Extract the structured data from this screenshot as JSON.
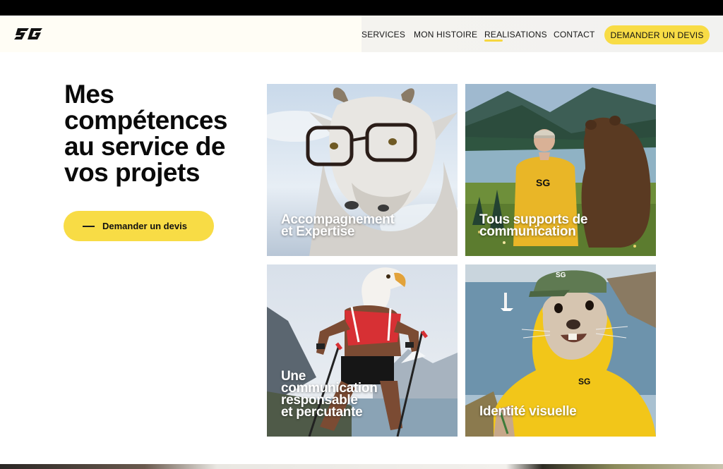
{
  "header": {
    "logo_text": "SG",
    "nav": [
      {
        "label": "SERVICES",
        "active": false
      },
      {
        "label": "MON HISTOIRE",
        "active": false
      },
      {
        "label": "REALISATIONS",
        "active": true
      },
      {
        "label": "CONTACT",
        "active": false
      }
    ],
    "cta_label": "DEMANDER UN DEVIS"
  },
  "hero": {
    "title": "Mes compétences au service de vos projets",
    "cta_label": "Demander un devis"
  },
  "cards": [
    {
      "caption": "Accompagnement\net Expertise",
      "icon": "goat-with-glasses-image"
    },
    {
      "caption": "Tous supports de\ncommunication",
      "icon": "man-and-bear-at-lake-image"
    },
    {
      "caption": "Une\ncommunication\nresponsable\net percutante",
      "icon": "eagle-runner-image"
    },
    {
      "caption": "Identité visuelle",
      "icon": "marmot-in-yellow-jacket-image"
    }
  ],
  "colors": {
    "accent": "#f8dc45",
    "text": "#0b0b0b",
    "topbar": "#000000"
  }
}
